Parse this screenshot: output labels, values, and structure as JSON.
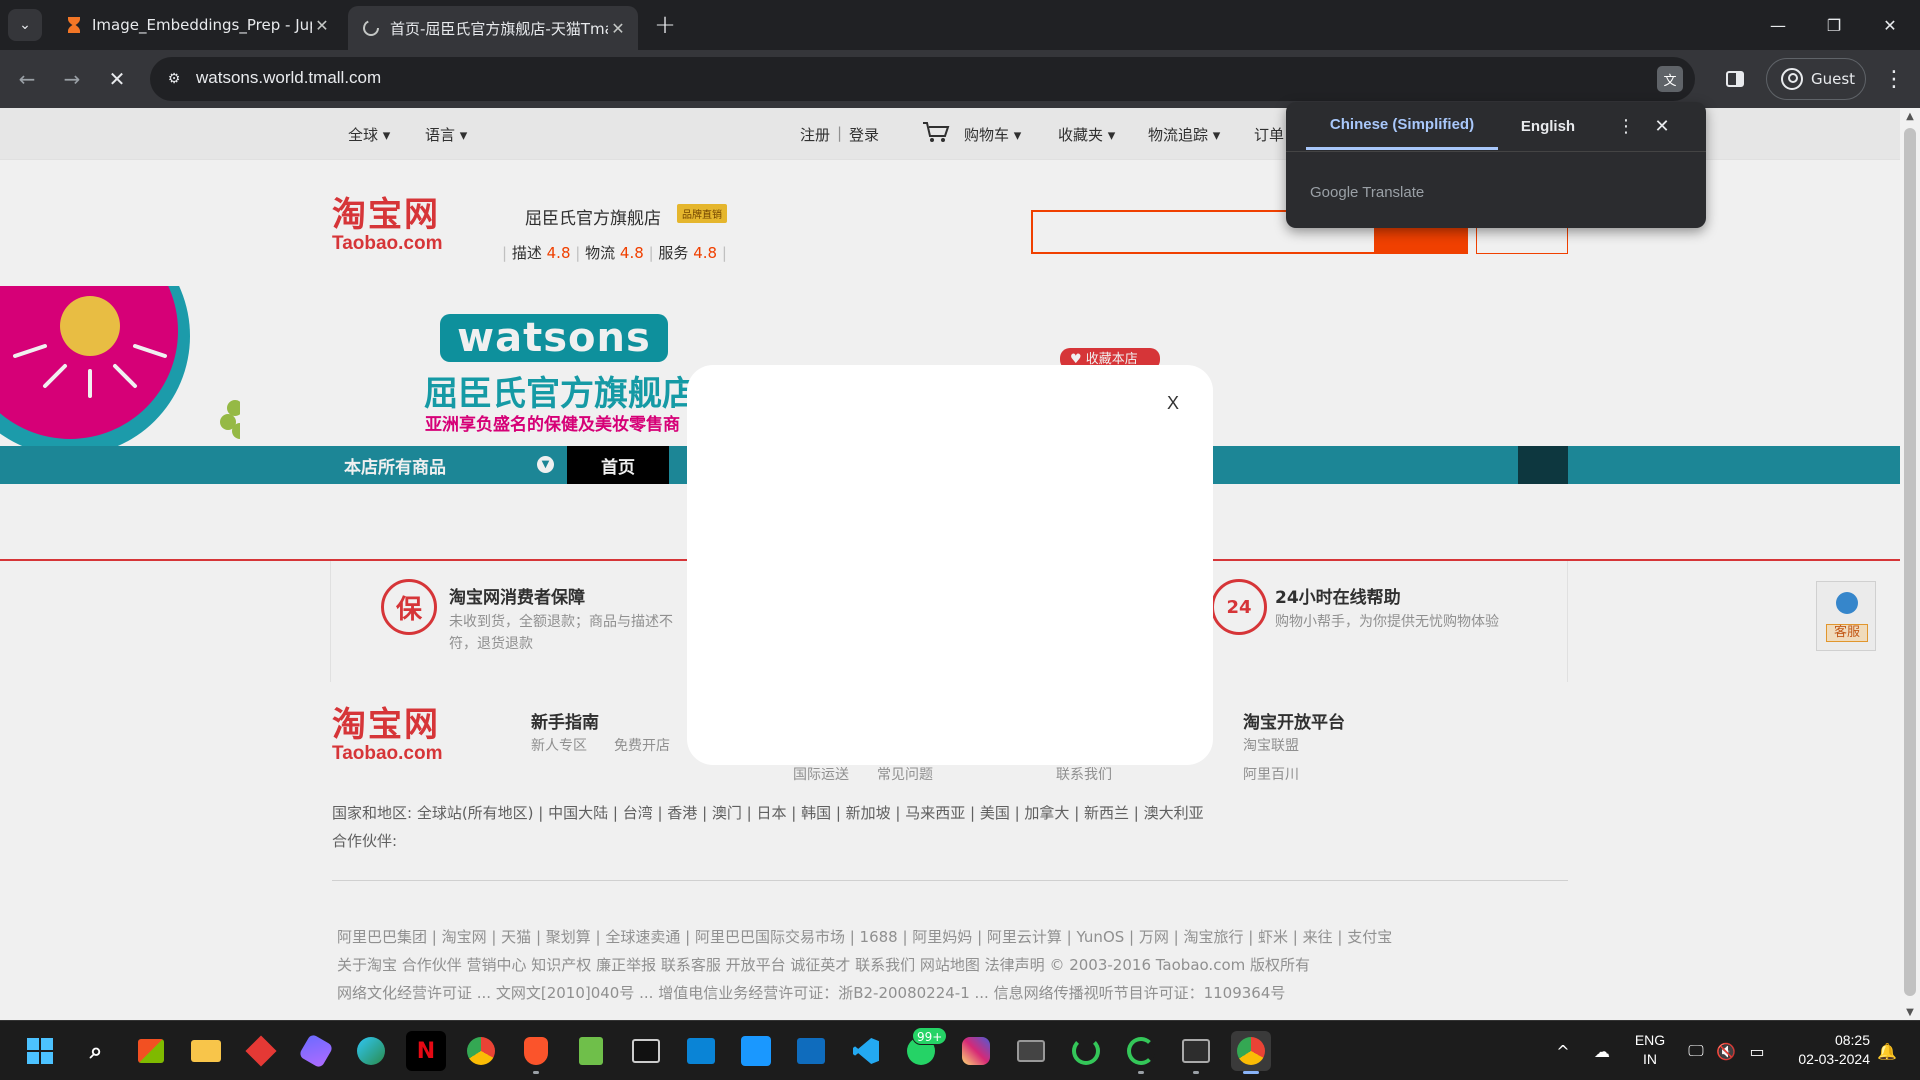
{
  "browser": {
    "tabs": [
      {
        "title": "Image_Embeddings_Prep - Jupyter",
        "icon": "hourglass-icon"
      },
      {
        "title": "首页-屈臣氏官方旗舰店-天猫Tmall",
        "icon": "loading-spinner-icon"
      }
    ],
    "url": "watsons.world.tmall.com",
    "profile_label": "Guest"
  },
  "translate_popup": {
    "source_lang": "Chinese (Simplified)",
    "target_lang": "English",
    "brand": "Google Translate"
  },
  "page": {
    "topnav": {
      "global": "全球 ▾",
      "language": "语言 ▾",
      "register": "注册",
      "separator": "|",
      "login": "登录",
      "cart": "购物车 ▾",
      "favorites": "收藏夹 ▾",
      "logistics": "物流追踪 ▾",
      "orders": "订单"
    },
    "header": {
      "logo_cn": "淘宝网",
      "logo_en": "Taobao.com",
      "shop_name": "屈臣氏官方旗舰店",
      "brand_badge": "品牌直销",
      "rating_desc_label": "描述",
      "rating_desc": "4.8",
      "rating_logistics_label": "物流",
      "rating_logistics": "4.8",
      "rating_service_label": "服务",
      "rating_service": "4.8"
    },
    "banner": {
      "logo_text": "watsons",
      "shop_title": "屈臣氏官方旗舰店",
      "slogan": "亚洲享负盛名的保健及美妆零售商",
      "fav_badge": "收藏本店"
    },
    "shop_nav": {
      "all_goods": "本店所有商品",
      "home": "首页"
    },
    "guarantee": {
      "consumer_title": "淘宝网消费者保障",
      "consumer_text_1": "未收到货，全额退款；商品与描述不",
      "consumer_text_2": "符，退货退款",
      "consumer_icon_char": "保",
      "help_title": "24小时在线帮助",
      "help_text": "购物小帮手，为你提供无忧购物体验",
      "help_icon_char": "24",
      "kefu_label": "客服"
    },
    "footer": {
      "logo_cn": "淘宝网",
      "logo_en": "Taobao.com",
      "guide_title": "新手指南",
      "guide_links": [
        "新人专区",
        "免费开店"
      ],
      "mid_links": [
        "国际运送",
        "常见问题"
      ],
      "contact_link": "联系我们",
      "platform_title": "淘宝开放平台",
      "platform_links": [
        "淘宝联盟",
        "阿里百川"
      ],
      "regions": "国家和地区: 全球站(所有地区)  |  中国大陆  |  台湾  |  香港  |  澳门  |  日本  |  韩国  |  新加坡  |  马来西亚  |  美国  |  加拿大  |  新西兰  |  澳大利亚",
      "partners": "合作伙伴:",
      "links_1": "阿里巴巴集团  |  淘宝网  |  天猫  |  聚划算  |  全球速卖通  |  阿里巴巴国际交易市场  |  1688  |  阿里妈妈  |  阿里云计算  |  YunOS  |  万网  |  淘宝旅行  |  虾米  |  来往  |  支付宝",
      "links_2": "关于淘宝  合作伙伴  营销中心  知识产权  廉正举报  联系客服  开放平台  诚征英才  联系我们  网站地图  法律声明       © 2003-2016 Taobao.com 版权所有",
      "links_3": "网络文化经营许可证 ... 文网文[2010]040号 ... 增值电信业务经营许可证：浙B2-20080224-1 ... 信息网络传播视听节目许可证：1109364号"
    }
  },
  "modal": {
    "close_label": "X"
  },
  "taskbar": {
    "whatsapp_badge": "99+",
    "lang_line1": "ENG",
    "lang_line2": "IN",
    "time": "08:25",
    "date": "02-03-2024"
  },
  "colors": {
    "taobao_red": "#e4393c",
    "watsons_teal": "#0f9aa6",
    "shop_nav_bg": "#1e8fa0",
    "translate_accent": "#a8c7fa"
  }
}
